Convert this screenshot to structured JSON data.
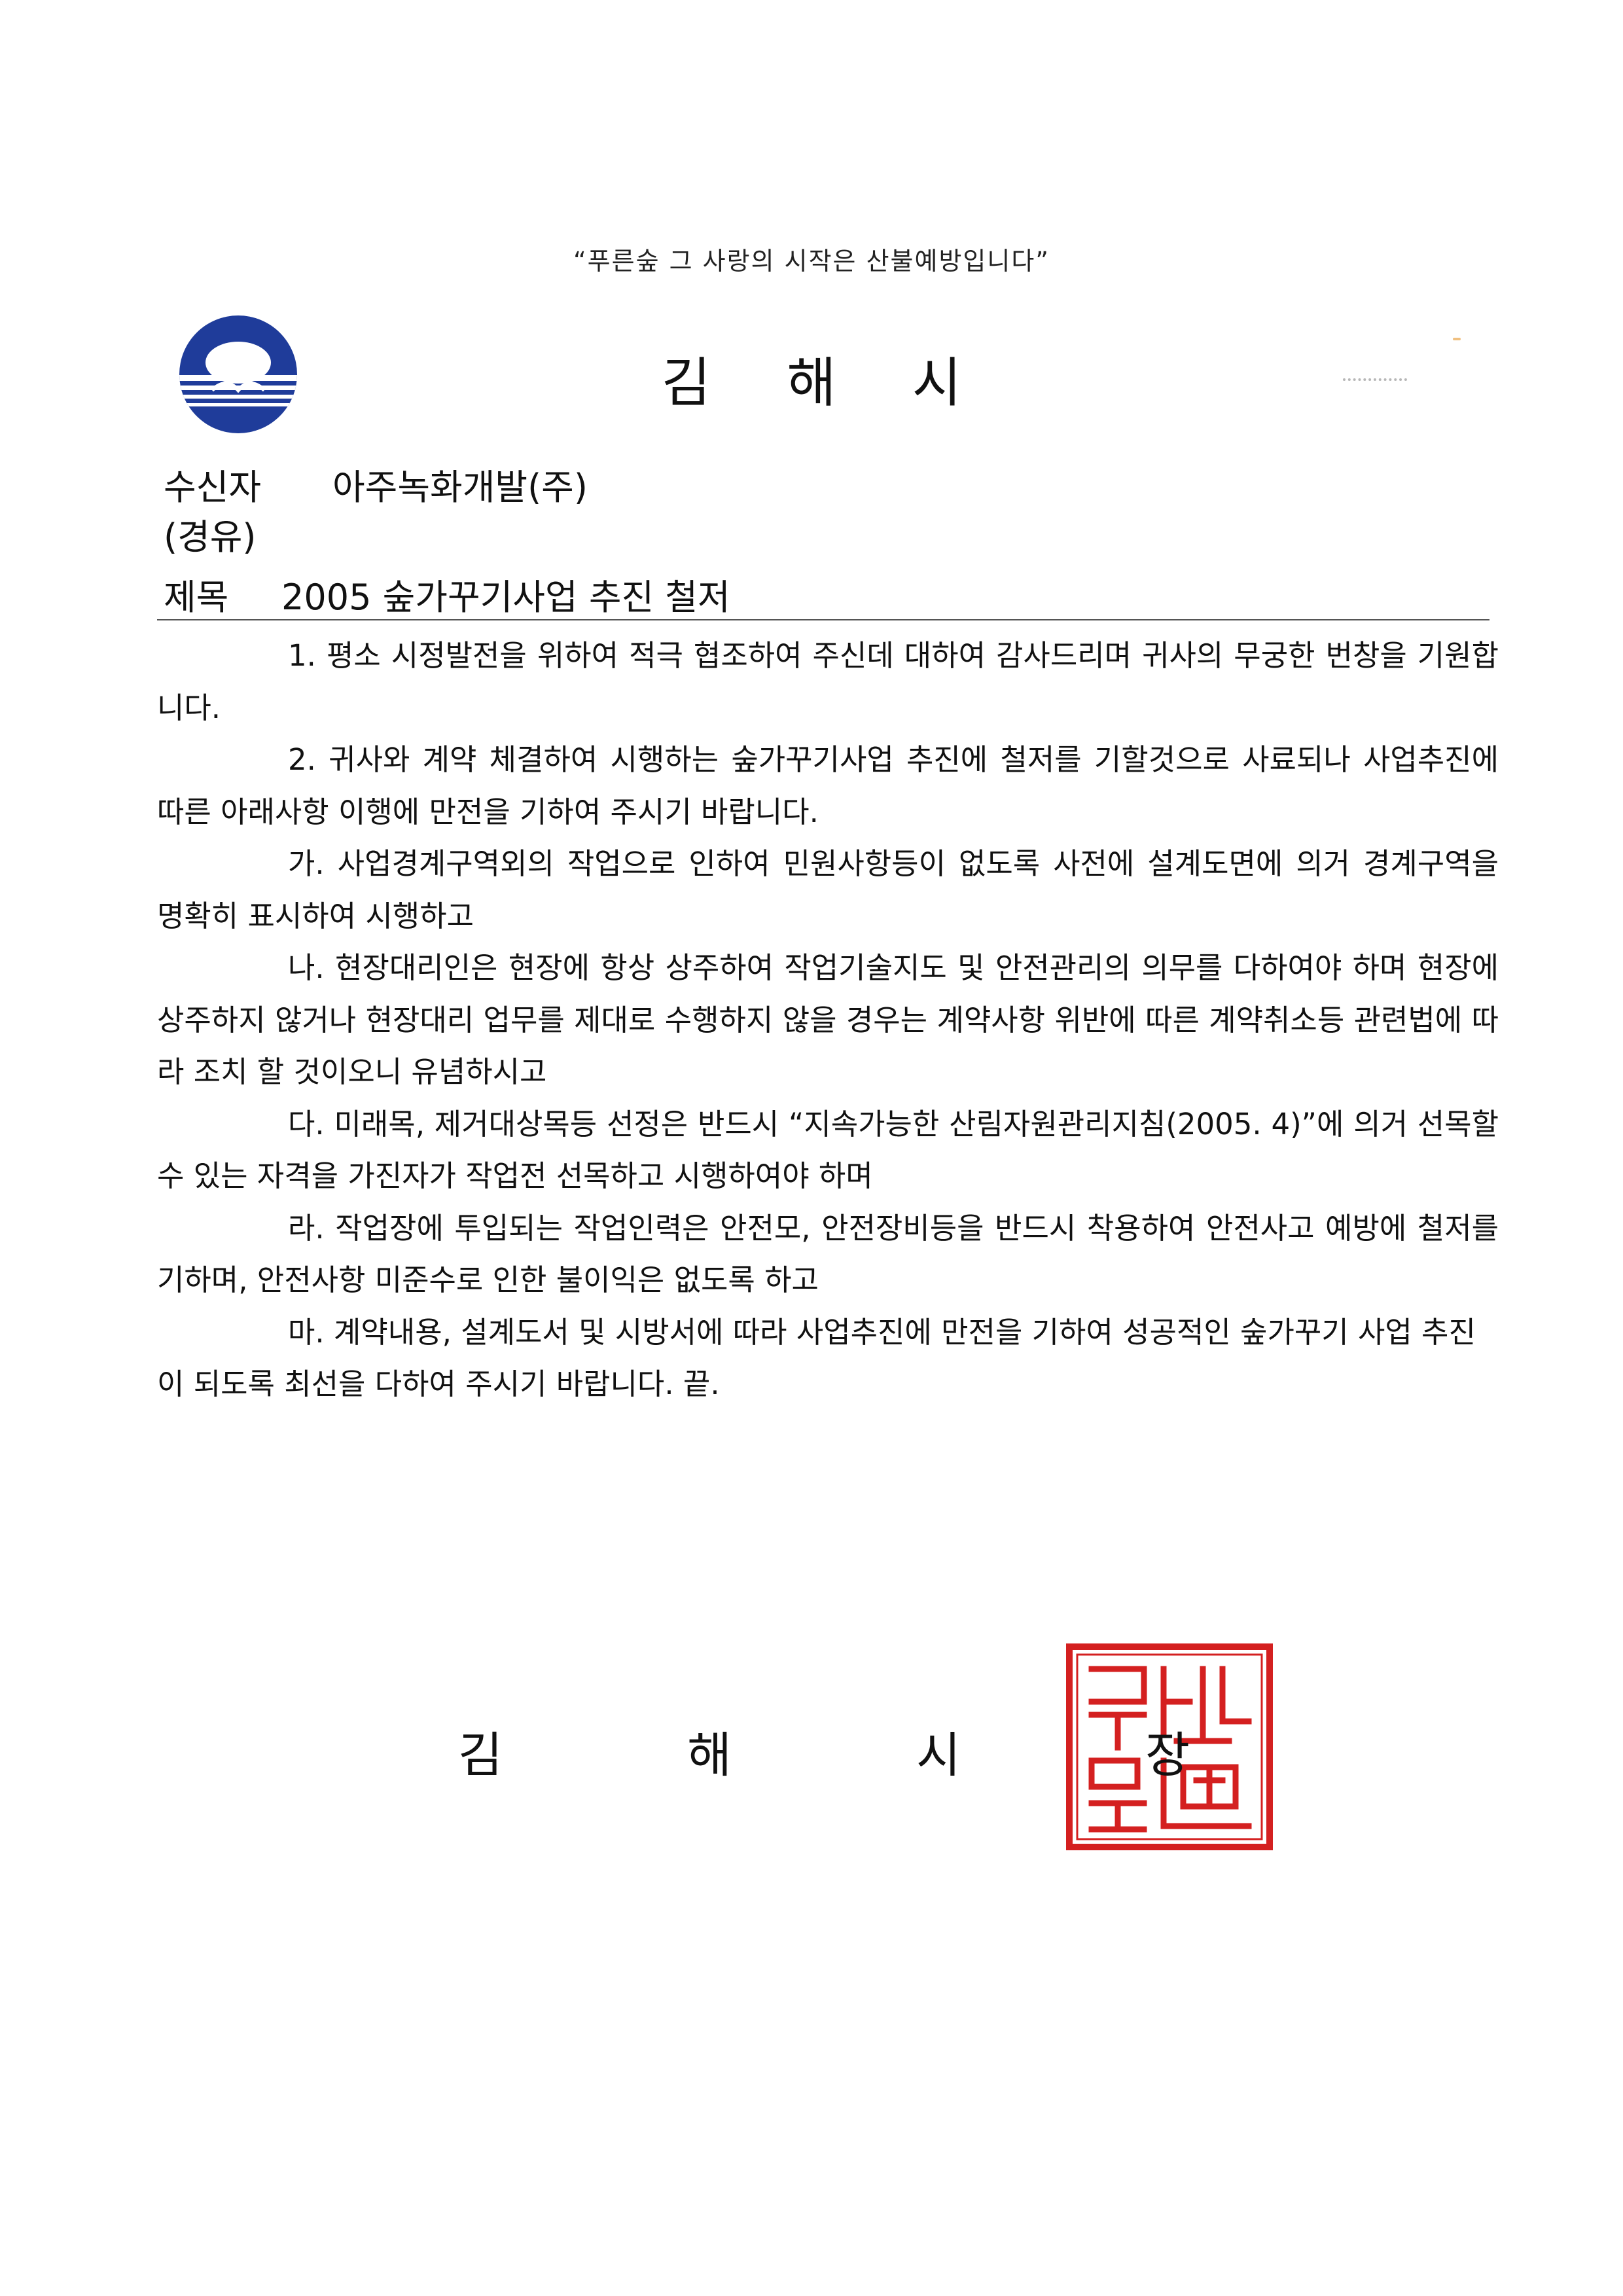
{
  "header": {
    "slogan": "“푸른숲 그 사랑의 시작은 산불예방입니다”",
    "org_title": "김 해 시",
    "emblem_icon": "gimhae-city-emblem-icon"
  },
  "meta": {
    "recipient_label": "수신자",
    "recipient_value": "아주녹화개발(주)",
    "via_label": "(경유)",
    "subject_label": "제목",
    "subject_value": "2005 숲가꾸기사업 추진 철저"
  },
  "body": {
    "paragraphs": [
      "1. 평소 시정발전을 위하여 적극 협조하여 주신데 대하여 감사드리며 귀사의 무궁한 번창을 기원합니다.",
      "2. 귀사와 계약 체결하여 시행하는 숲가꾸기사업 추진에 철저를 기할것으로 사료되나 사업추진에 따른 아래사항 이행에 만전을 기하여 주시기 바랍니다.",
      "가. 사업경계구역외의 작업으로 인하여 민원사항등이 없도록 사전에 설계도면에 의거 경계구역을 명확히 표시하여 시행하고",
      "나. 현장대리인은 현장에 항상 상주하여 작업기술지도 및 안전관리의 의무를 다하여야 하며 현장에 상주하지 않거나 현장대리 업무를 제대로 수행하지 않을 경우는 계약사항 위반에 따른 계약취소등 관련법에 따라 조치 할 것이오니 유념하시고",
      "다. 미래목, 제거대상목등 선정은 반드시 “지속가능한 산림자원관리지침(2005. 4)”에 의거 선목할수 있는 자격을 가진자가 작업전 선목하고 시행하여야 하며",
      "라. 작업장에 투입되는 작업인력은 안전모, 안전장비등을 반드시 착용하여 안전사고 예방에 철저를 기하며, 안전사항 미준수로 인한 불이익은 없도록 하고",
      "마. 계약내용, 설계도서 및 시방서에 따라 사업추진에 만전을 기하여 성공적인 숲가꾸기 사업 추진이 되도록 최선을 다하여 주시기 바랍니다. 끝."
    ]
  },
  "signature": {
    "chars": [
      "김",
      "해",
      "시",
      "장"
    ],
    "seal_icon": "official-seal-icon",
    "seal_text": "김해시장의인",
    "seal_color": "#d42020"
  },
  "colors": {
    "emblem_blue": "#1f3c9a",
    "text": "#111111"
  }
}
